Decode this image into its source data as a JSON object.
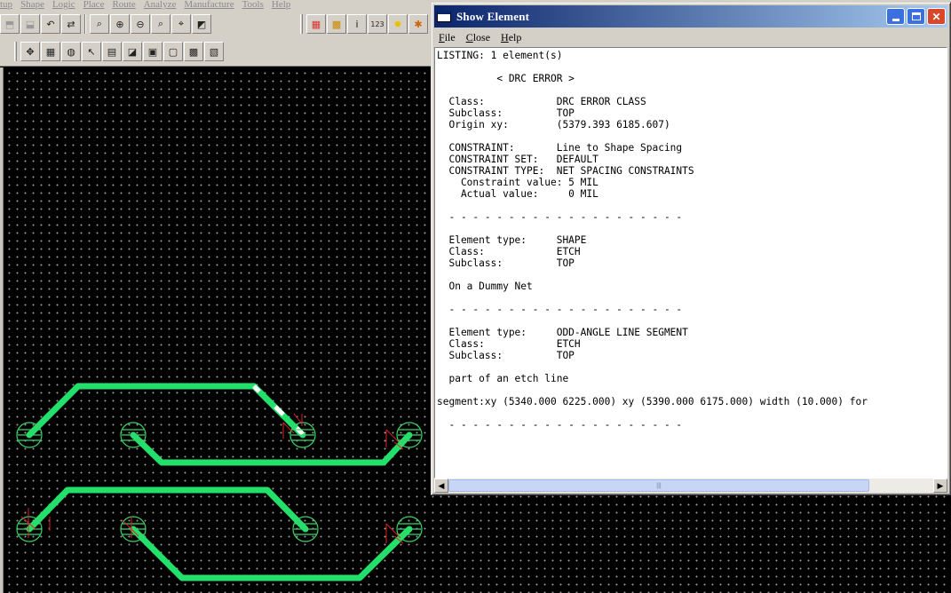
{
  "app": {
    "menu": [
      "tup",
      "Shape",
      "Logic",
      "Place",
      "Route",
      "Analyze",
      "Manufacture",
      "Tools",
      "Help"
    ],
    "toolbar_row1": [
      "open-icon",
      "save-icon",
      "undo-icon",
      "redo-icon",
      "zoom-fit-icon",
      "zoom-in-icon",
      "zoom-out-icon",
      "zoom-world-icon",
      "zoom-center-icon",
      "3d-view-icon"
    ],
    "toolbar_row2": [
      "move-icon",
      "grid-icon",
      "via-icon",
      "select-icon",
      "copy-icon",
      "mirror-icon",
      "rotate-icon",
      "spin-icon",
      "group-icon",
      "delete-icon"
    ],
    "toolbar_right": [
      "color-icon",
      "layer-icon",
      "info-icon",
      "measure-icon",
      "highlight-icon",
      "drc-icon"
    ],
    "toolbar_right_labels": {
      "info": "i",
      "measure": "123"
    }
  },
  "show_element": {
    "title": "Show Element",
    "menu": [
      {
        "label": "File",
        "accel": "F",
        "rest": "ile"
      },
      {
        "label": "Close",
        "accel": "C",
        "rest": "lose"
      },
      {
        "label": "Help",
        "accel": "H",
        "rest": "elp"
      }
    ],
    "listing_lines": [
      "LISTING: 1 element(s)",
      "",
      "          < DRC ERROR >",
      "",
      "  Class:            DRC ERROR CLASS",
      "  Subclass:         TOP",
      "  Origin xy:        (5379.393 6185.607)",
      "",
      "  CONSTRAINT:       Line to Shape Spacing",
      "  CONSTRAINT SET:   DEFAULT",
      "  CONSTRAINT TYPE:  NET SPACING CONSTRAINTS",
      "    Constraint value: 5 MIL",
      "    Actual value:     0 MIL",
      "",
      "  - - - - - - - - - - - - - - - - - - - -",
      "",
      "  Element type:     SHAPE",
      "  Class:            ETCH",
      "  Subclass:         TOP",
      "",
      "  On a Dummy Net",
      "",
      "  - - - - - - - - - - - - - - - - - - - -",
      "",
      "  Element type:     ODD-ANGLE LINE SEGMENT",
      "  Class:            ETCH",
      "  Subclass:         TOP",
      "",
      "  part of an etch line",
      "",
      "segment:xy (5340.000 6225.000) xy (5390.000 6175.000) width (10.000) for",
      "",
      "  - - - - - - - - - - - - - - - - - - - -"
    ]
  },
  "colors": {
    "trace": "#22e06a",
    "pad_ring": "#3ad46a",
    "drc_marker": "#e02020",
    "canvas_bg": "#000000",
    "title_start": "#0a246a",
    "title_end": "#a6caf0"
  }
}
